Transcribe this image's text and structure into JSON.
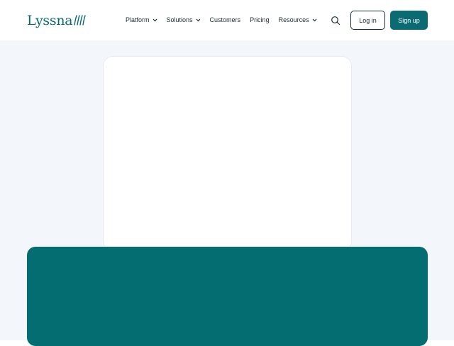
{
  "brand": {
    "name": "Lyssna",
    "color": "#0b6b73"
  },
  "nav": {
    "items": [
      {
        "label": "Platform",
        "has_dropdown": true
      },
      {
        "label": "Solutions",
        "has_dropdown": true
      },
      {
        "label": "Customers",
        "has_dropdown": false
      },
      {
        "label": "Pricing",
        "has_dropdown": false
      },
      {
        "label": "Resources",
        "has_dropdown": true
      }
    ]
  },
  "header": {
    "search_icon": "search-icon",
    "login_label": "Log in",
    "signup_label": "Sign up"
  },
  "colors": {
    "accent": "#0b6b73",
    "panel": "#036d72",
    "hero_background": "#f3f6fa",
    "text": "#1c2b33"
  }
}
